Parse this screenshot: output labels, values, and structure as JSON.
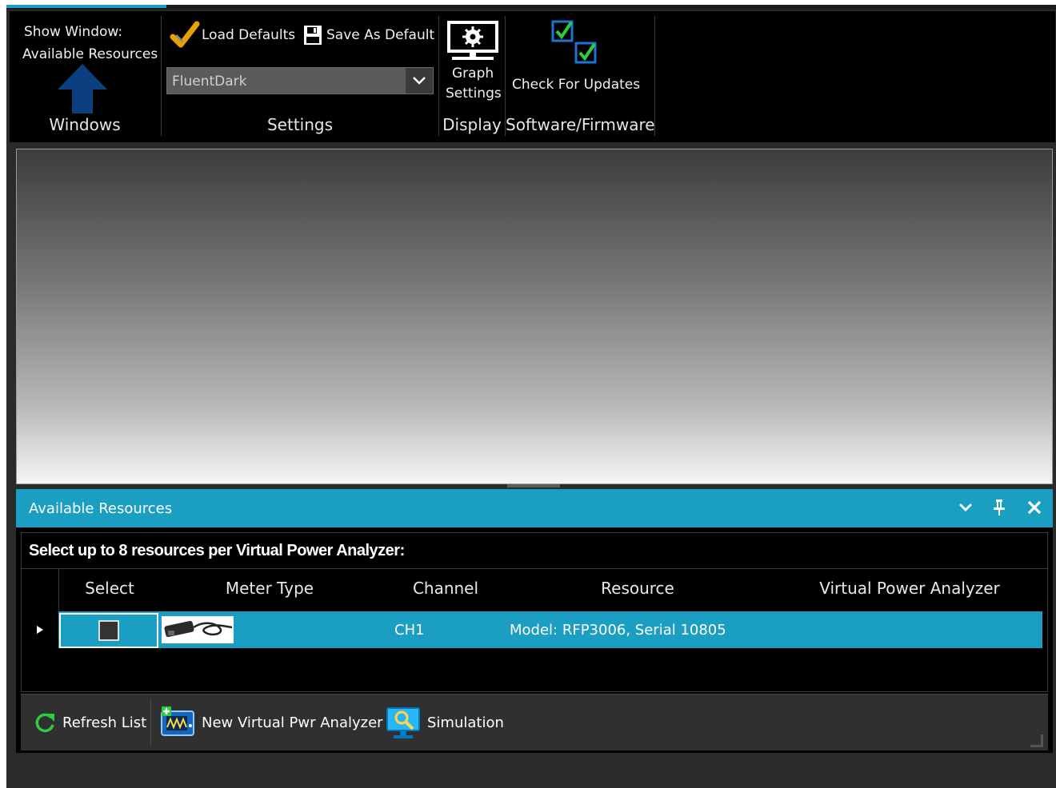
{
  "ribbon": {
    "windows": {
      "show_label_line1": "Show Window:",
      "show_label_line2": "Available Resources",
      "group_label": "Windows"
    },
    "settings": {
      "load_defaults": "Load Defaults",
      "save_as_default": "Save As Default",
      "theme_value": "FluentDark",
      "group_label": "Settings"
    },
    "display": {
      "graph_settings_line1": "Graph",
      "graph_settings_line2": "Settings",
      "group_label": "Display"
    },
    "software": {
      "check_updates": "Check For Updates",
      "group_label": "Software/Firmware"
    }
  },
  "panel": {
    "title": "Available Resources",
    "instruction": "Select up to 8 resources per Virtual Power Analyzer:",
    "columns": [
      "Select",
      "Meter Type",
      "Channel",
      "Resource",
      "Virtual Power Analyzer"
    ],
    "rows": [
      {
        "channel": "CH1",
        "resource": "Model: RFP3006, Serial 10805",
        "virtual_power_analyzer": ""
      }
    ],
    "toolbar": {
      "refresh": "Refresh List",
      "new_vpa": "New Virtual Pwr Analyzer",
      "simulation": "Simulation"
    }
  },
  "colors": {
    "accent": "#1a9ec2",
    "ribbon_bg": "#000000",
    "panel_bg": "#000000"
  }
}
